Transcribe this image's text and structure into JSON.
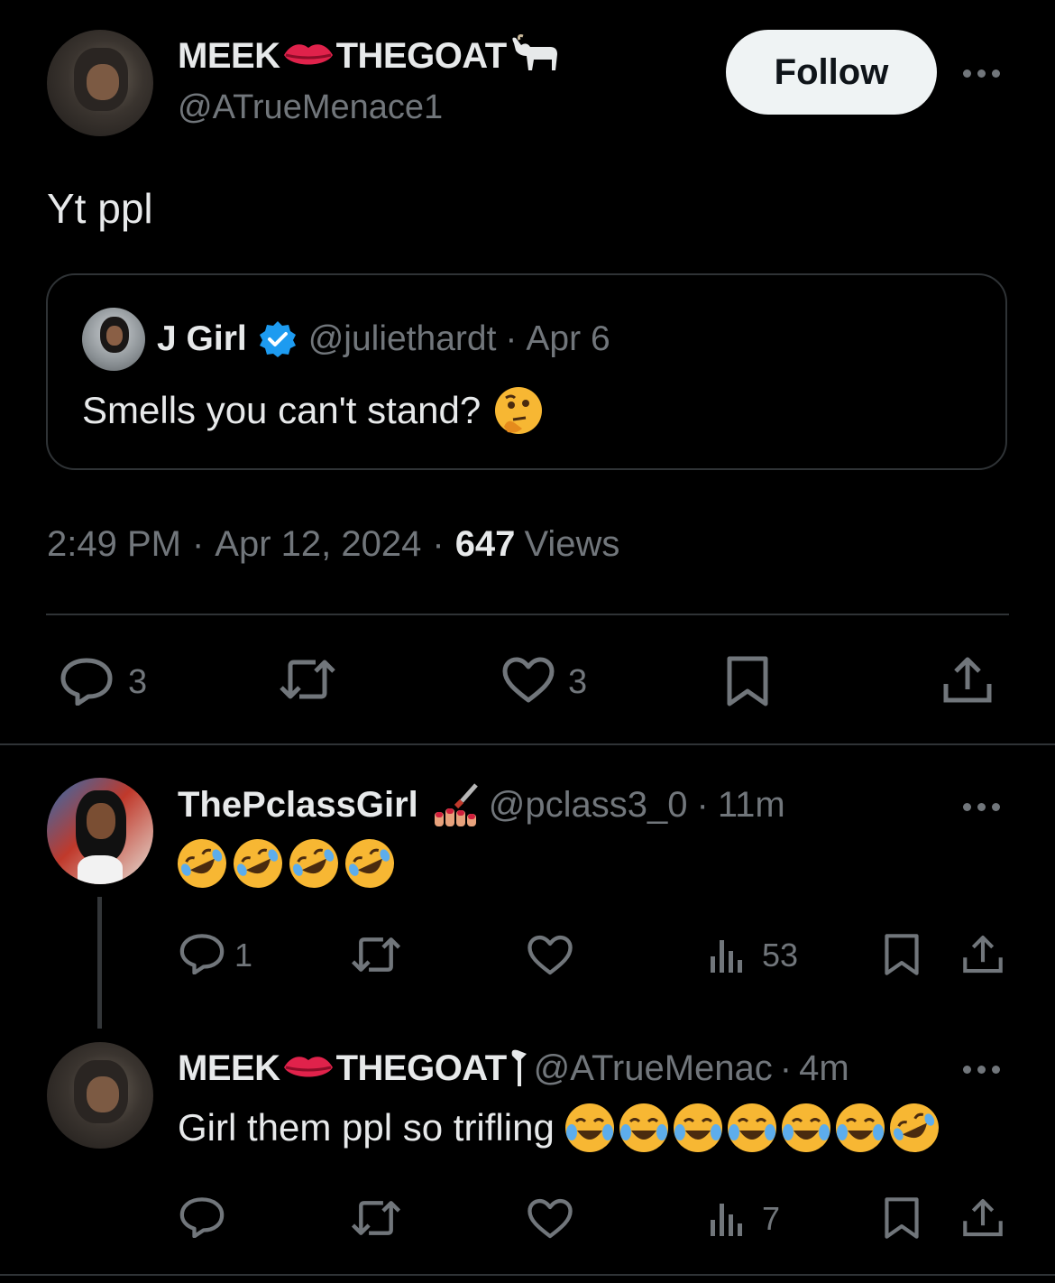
{
  "main_tweet": {
    "display_name_part1": "MEEK",
    "display_name_part2": "THEGOAT",
    "handle": "@ATrueMenace1",
    "follow_label": "Follow",
    "text": "Yt ppl",
    "time": "2:49 PM",
    "sep1": "·",
    "date": "Apr 12, 2024",
    "sep2": "·",
    "views_count": "647",
    "views_label": "Views",
    "reply_count": "3",
    "like_count": "3"
  },
  "quoted_tweet": {
    "display_name": "J Girl",
    "handle": "@juliethardt",
    "sep": "·",
    "date": "Apr 6",
    "text": "Smells you can't stand?"
  },
  "reply1": {
    "display_name": "ThePclassGirl",
    "handle": "@pclass3_0",
    "sep": "·",
    "age": "11m",
    "reply_count": "1",
    "views_count": "53"
  },
  "reply2": {
    "display_name_part1": "MEEK",
    "display_name_part2": "THEGOAT",
    "handle": "@ATrueMenac",
    "sep": "·",
    "age": "4m",
    "text": "Girl them ppl so trifling",
    "views_count": "7"
  },
  "colors": {
    "background": "#000000",
    "text_primary": "#e7e9ea",
    "text_muted": "#71767b",
    "border": "#2f3336",
    "verified_blue": "#1d9bf0",
    "follow_bg": "#eff3f4"
  },
  "icons": [
    "lips-icon",
    "goat-icon",
    "verified-badge-icon",
    "thinking-face-icon",
    "nail-polish-icon",
    "rolling-laughing-icon",
    "tears-of-joy-icon",
    "reply-icon",
    "retweet-icon",
    "like-icon",
    "bookmark-icon",
    "share-icon",
    "views-icon",
    "more-icon"
  ]
}
